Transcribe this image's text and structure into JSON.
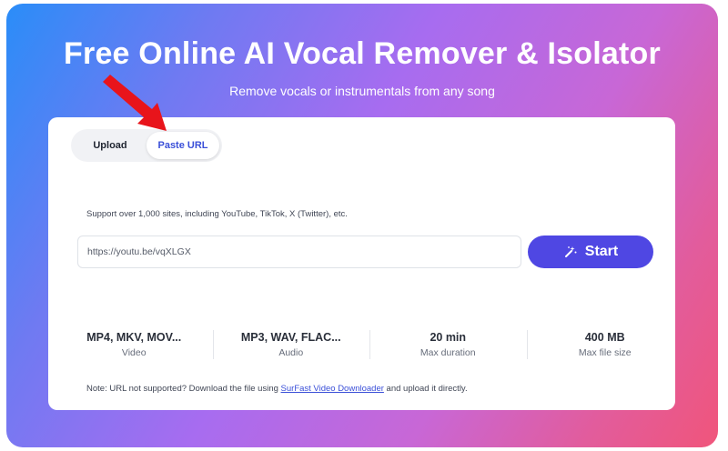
{
  "hero": {
    "title": "Free Online AI Vocal Remover & Isolator",
    "subtitle": "Remove vocals or instrumentals from any song"
  },
  "tabs": [
    {
      "label": "Upload",
      "active": false
    },
    {
      "label": "Paste URL",
      "active": true
    }
  ],
  "url_section": {
    "support_text": "Support over 1,000 sites, including YouTube, TikTok, X (Twitter), etc.",
    "input_value": "https://youtu.be/vqXLGX",
    "start_label": "Start",
    "start_icon": "wand-icon"
  },
  "stats": [
    {
      "value": "MP4, MKV, MOV...",
      "label": "Video"
    },
    {
      "value": "MP3, WAV, FLAC...",
      "label": "Audio"
    },
    {
      "value": "20 min",
      "label": "Max duration"
    },
    {
      "value": "400 MB",
      "label": "Max file size"
    }
  ],
  "note": {
    "prefix": "Note: URL not supported? Download the file using ",
    "link_text": "SurFast Video Downloader",
    "suffix": " and upload it directly."
  },
  "annotation": {
    "icon": "red-arrow-icon",
    "color": "#e8141b"
  },
  "colors": {
    "accent": "#4f47e3",
    "active_tab_text": "#3a4fd8",
    "gradient_start": "#2a8df8",
    "gradient_end": "#f0557b"
  }
}
